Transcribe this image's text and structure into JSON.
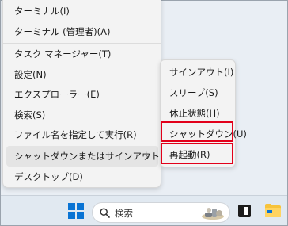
{
  "context_menu": {
    "items": [
      {
        "label": "ターミナル(I)"
      },
      {
        "label": "ターミナル (管理者)(A)"
      },
      {
        "label": "タスク マネージャー(T)"
      },
      {
        "label": "設定(N)"
      },
      {
        "label": "エクスプローラー(E)"
      },
      {
        "label": "検索(S)"
      },
      {
        "label": "ファイル名を指定して実行(R)"
      },
      {
        "label": "シャットダウンまたはサインアウト(U)",
        "has_submenu": true,
        "chevron": "›"
      },
      {
        "label": "デスクトップ(D)"
      }
    ]
  },
  "submenu": {
    "items": [
      {
        "label": "サインアウト(I)"
      },
      {
        "label": "スリープ(S)"
      },
      {
        "label": "休止状態(H)"
      },
      {
        "label": "シャットダウン(U)",
        "highlighted_box": true
      },
      {
        "label": "再起動(R)",
        "highlighted_box": true
      }
    ]
  },
  "taskbar": {
    "search_placeholder": "検索",
    "icons": [
      "windows-start-icon",
      "search-icon",
      "landscape-thumbnail-icon",
      "task-view-icon",
      "file-explorer-icon"
    ]
  },
  "colors": {
    "highlight_box": "#e2001a",
    "windows_blue": "#0a74d4",
    "folder_yellow": "#f7c33b"
  }
}
